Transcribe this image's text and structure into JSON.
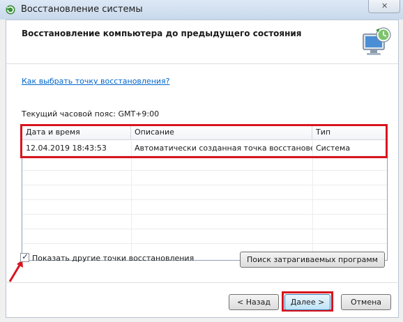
{
  "window": {
    "title": "Восстановление системы"
  },
  "header": {
    "title": "Восстановление компьютера до предыдущего состояния"
  },
  "body": {
    "help_link": "Как выбрать точку восстановления?",
    "timezone": "Текущий часовой пояс: GMT+9:00"
  },
  "table": {
    "columns": [
      "Дата и время",
      "Описание",
      "Тип"
    ],
    "rows": [
      {
        "date": "12.04.2019 18:43:53",
        "description": "Автоматически созданная точка восстанове...",
        "type": "Система"
      }
    ]
  },
  "options": {
    "show_more_label": "Показать другие точки восстановления",
    "show_more_checked": true
  },
  "buttons": {
    "scan": "Поиск затрагиваемых программ",
    "back": "< Назад",
    "next": "Далее >",
    "cancel": "Отмена"
  },
  "colors": {
    "highlight": "#d8141e",
    "link": "#0066cc"
  }
}
